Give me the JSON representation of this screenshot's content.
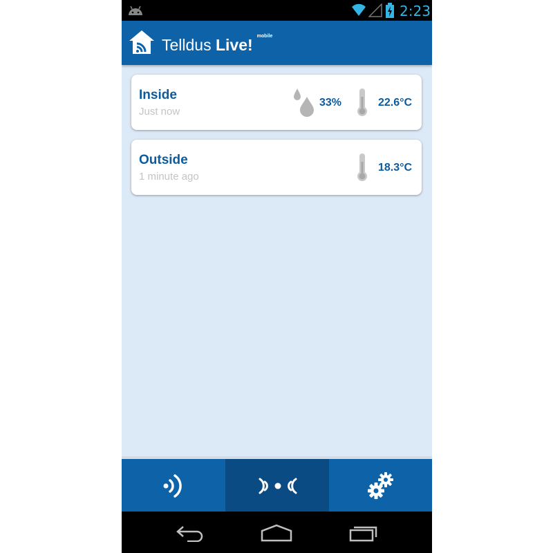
{
  "status_bar": {
    "time": "2:23",
    "accent_color": "#33b5e5",
    "icons": [
      "android-icon",
      "wifi-icon",
      "signal-icon",
      "battery-charging-icon"
    ]
  },
  "header": {
    "title_regular": "Telldus ",
    "title_bold": "Live!",
    "title_suffix": "mobile",
    "background_color": "#0d62a8",
    "logo_icon": "house-signal-icon"
  },
  "sensors": [
    {
      "name": "Inside",
      "updated": "Just now",
      "humidity": "33%",
      "temperature": "22.6°C",
      "icons": [
        "humidity-drops-icon",
        "thermometer-icon"
      ]
    },
    {
      "name": "Outside",
      "updated": "1 minute ago",
      "temperature": "18.3°C",
      "icons": [
        "thermometer-icon"
      ]
    }
  ],
  "tabs": [
    {
      "icon": "devices-signal-icon",
      "selected": false
    },
    {
      "icon": "sensors-icon",
      "selected": true
    },
    {
      "icon": "settings-gears-icon",
      "selected": false
    }
  ],
  "nav_bar": {
    "icons": [
      "back-icon",
      "home-icon",
      "recent-apps-icon"
    ]
  },
  "colors": {
    "card_title": "#0d5a9c",
    "card_subtitle": "#c4c4c4",
    "content_background": "#dce9f6",
    "selected_tab": "#094b82"
  }
}
